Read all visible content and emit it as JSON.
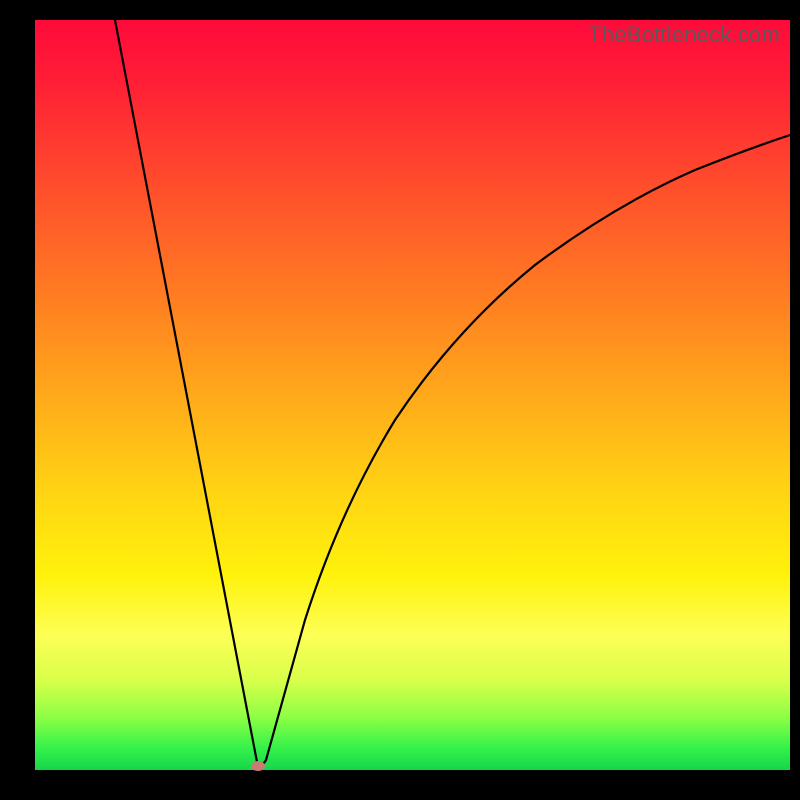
{
  "watermark": "TheBottleneck.com",
  "chart_data": {
    "type": "line",
    "title": "",
    "xlabel": "",
    "ylabel": "",
    "xlim": [
      0,
      100
    ],
    "ylim": [
      0,
      100
    ],
    "grid": false,
    "legend": false,
    "note": "Bottleneck-style asymmetrical V/cusp curve over a red→green vertical gradient. Values are read from pixel positions (no axes rendered).",
    "cusp": {
      "x": 29.5,
      "y": 0
    },
    "series": [
      {
        "name": "left-branch",
        "x": [
          10.6,
          14,
          18,
          22,
          26,
          29.5
        ],
        "y": [
          100,
          82,
          61,
          40,
          19,
          0
        ]
      },
      {
        "name": "right-branch",
        "x": [
          29.5,
          31,
          33,
          36,
          40,
          45,
          52,
          60,
          70,
          82,
          100
        ],
        "y": [
          0,
          10,
          21,
          33,
          44,
          54,
          63,
          70,
          76,
          81,
          85
        ]
      }
    ],
    "marker": {
      "x": 29.5,
      "y": 0,
      "color": "#c77c74"
    },
    "colors": {
      "gradient_top": "#ff0a3a",
      "gradient_mid": "#ffd413",
      "gradient_bottom": "#16d64a",
      "curve": "#000000",
      "frame": "#000000",
      "watermark": "#5a5a5a"
    }
  }
}
